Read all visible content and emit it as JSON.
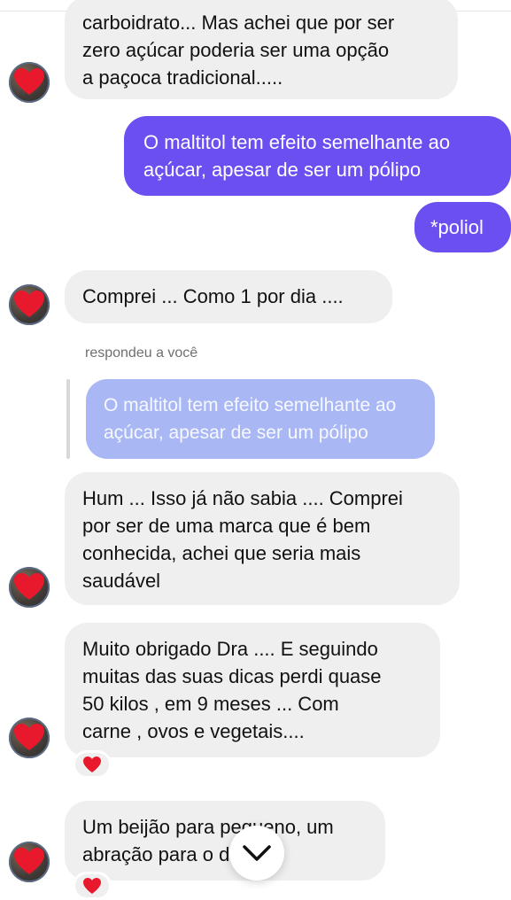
{
  "messages": {
    "m1": "carboidrato... Mas achei que por ser\nzero açúcar poderia ser uma opção\na paçoca tradicional.....",
    "m2": "O maltitol tem efeito semelhante ao\naçúcar, apesar de ser um pólipo",
    "m3": "*poliol",
    "m4": "Comprei ...  Como 1 por dia ....",
    "reply_label": "respondeu a você",
    "quoted": "O maltitol tem efeito semelhante ao\naçúcar, apesar de ser um pólipo",
    "m5": "Hum ... Isso já não sabia .... Comprei\npor ser de uma marca que é bem\nconhecida, achei que seria mais\nsaudável",
    "m6": "Muito obrigado Dra .... E seguindo\nmuitas das suas dicas perdi quase\n50 kilos , em 9 meses ... Com\ncarne , ovos e vegetais....",
    "m7": "Um beijão para pequeno, um\nabração para o        dão...."
  },
  "colors": {
    "outgoing": "#6b4ff0",
    "incoming": "#efeff0",
    "quoted": "#a9b8f5",
    "heart": "#e8192c"
  },
  "icons": {
    "avatar": "heart-avatar",
    "reaction": "heart-icon",
    "scroll": "chevron-down-icon"
  }
}
